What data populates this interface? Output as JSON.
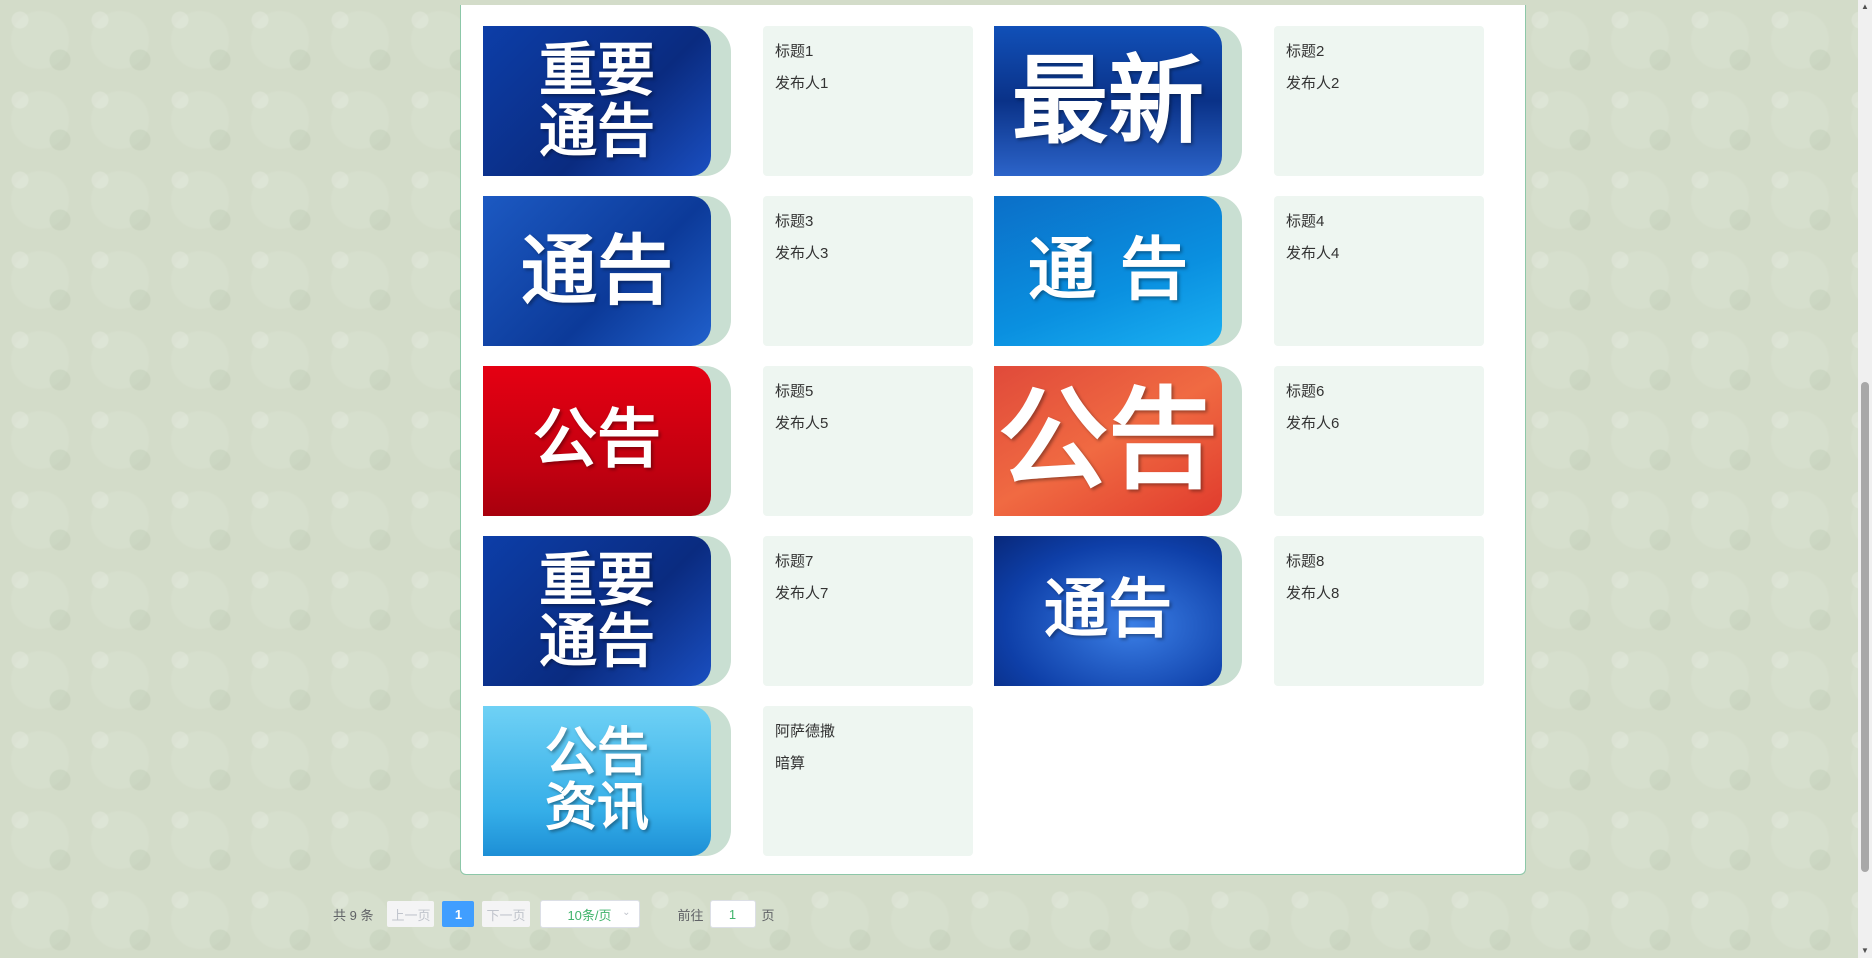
{
  "notices": [
    {
      "title": "标题1",
      "publisher": "发布人1",
      "image_text": "重要\n通告",
      "image_icon": "important-notice-image",
      "theme": "th-navy",
      "font_size": "58px"
    },
    {
      "title": "标题2",
      "publisher": "发布人2",
      "image_text": "最新",
      "image_icon": "latest-image",
      "theme": "th-blue-streak",
      "font_size": "96px"
    },
    {
      "title": "标题3",
      "publisher": "发布人3",
      "image_text": "通告",
      "image_icon": "notice-image",
      "theme": "th-blue-dark",
      "font_size": "76px"
    },
    {
      "title": "标题4",
      "publisher": "发布人4",
      "image_text": "通 告",
      "image_icon": "notice-image",
      "theme": "th-blue-light",
      "font_size": "68px"
    },
    {
      "title": "标题5",
      "publisher": "发布人5",
      "image_text": "公告",
      "image_icon": "announcement-image",
      "theme": "th-red",
      "font_size": "64px"
    },
    {
      "title": "标题6",
      "publisher": "发布人6",
      "image_text": "公告",
      "image_icon": "announcement-image",
      "theme": "th-orange",
      "font_size": "110px"
    },
    {
      "title": "标题7",
      "publisher": "发布人7",
      "image_text": "重要\n通告",
      "image_icon": "important-notice-image",
      "theme": "th-navy",
      "font_size": "58px"
    },
    {
      "title": "标题8",
      "publisher": "发布人8",
      "image_text": "通告",
      "image_icon": "notice-image",
      "theme": "th-blue-royal",
      "font_size": "64px"
    },
    {
      "title": "阿萨德撒",
      "publisher": "暗算",
      "image_text": "公告\n资讯",
      "image_icon": "megaphone-image",
      "theme": "th-sky",
      "font_size": "52px"
    }
  ],
  "pagination": {
    "total": "共 9 条",
    "prev": "上一页",
    "current_page": "1",
    "next": "下一页",
    "page_size": "10条/页",
    "goto_label": "前往",
    "goto_value": "1",
    "page_suffix": "页"
  },
  "icons": {
    "size_chevron": "chevron-down-icon",
    "scroll_up": "arrow-up-icon",
    "scroll_down": "arrow-down-icon"
  },
  "colors": {
    "accent": "#409eff",
    "card_bg": "#eef6f1",
    "panel_border": "#8cc7a8",
    "page_size_text": "#40b36b"
  }
}
